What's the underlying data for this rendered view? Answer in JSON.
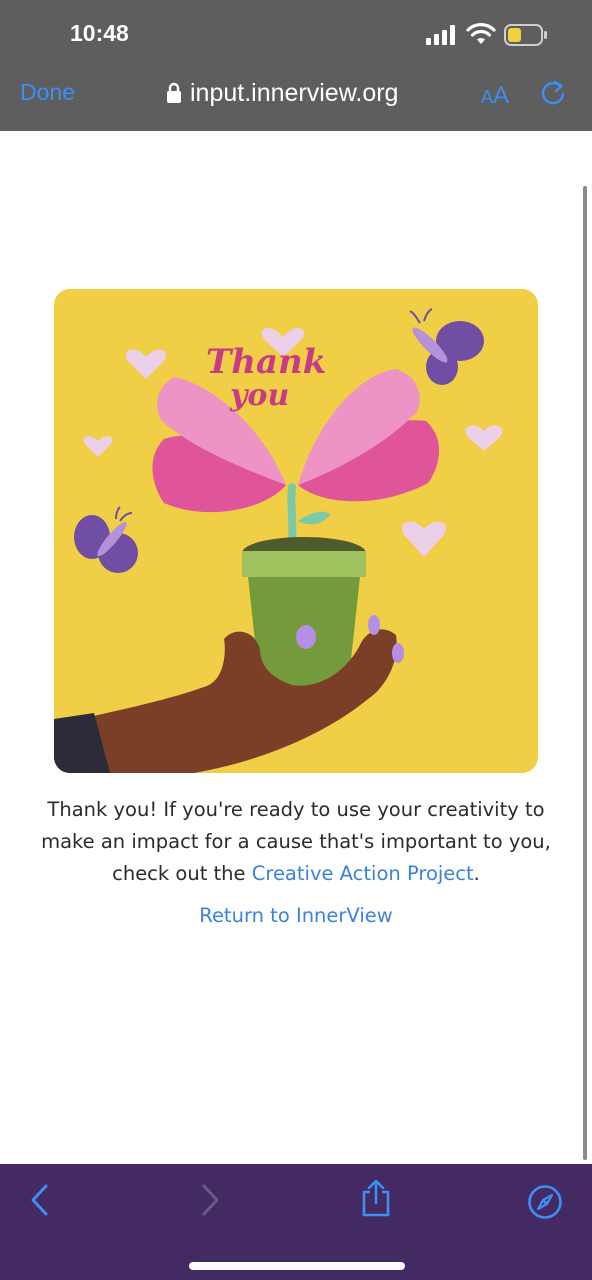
{
  "status_bar": {
    "time": "10:48",
    "icons": [
      "cellular-signal-icon",
      "wifi-icon",
      "battery-icon"
    ],
    "battery_color": "#f2d13f"
  },
  "browser": {
    "done_label": "Done",
    "url": "input.innerview.org",
    "aa_small": "A",
    "aa_big": "A",
    "icons": [
      "lock-icon",
      "reload-icon"
    ],
    "accent_color": "#3d8ef5"
  },
  "card": {
    "illustration_text": [
      "Thank",
      "you"
    ],
    "background_color": "#f0ce45",
    "description": "Illustration of a hand holding a potted flower with pink petals, butterflies and hearts"
  },
  "content": {
    "message_line1": "Thank you! If you're ready to use your creativity to",
    "message_line2": "make an impact for a cause that's important to you,",
    "message_line3_prefix": "check out the ",
    "link_label": "Creative Action Project",
    "message_line3_suffix": ".",
    "return_label": "Return to InnerView"
  },
  "toolbar": {
    "background": "#442a63",
    "buttons": [
      "back-icon",
      "forward-icon",
      "share-icon",
      "safari-compass-icon"
    ]
  }
}
